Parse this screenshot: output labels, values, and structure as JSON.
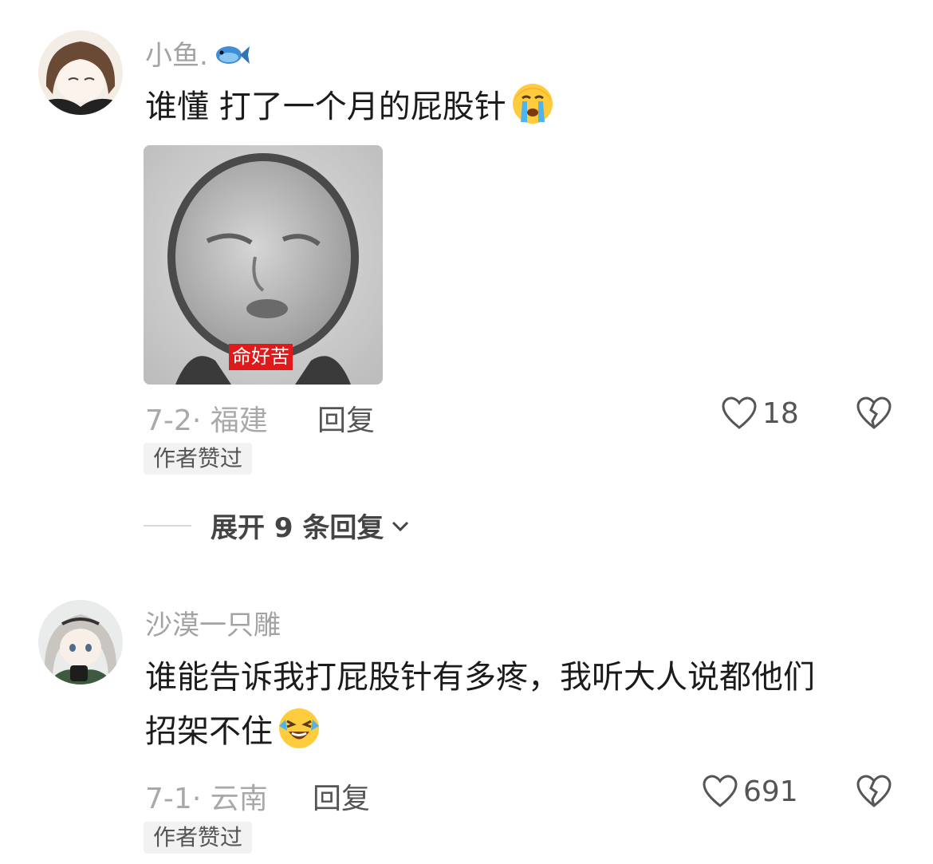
{
  "comments": [
    {
      "username": "小鱼.",
      "username_icon": "fish-icon",
      "text": "谁懂 打了一个月的屁股针",
      "text_emoji": "crying-face-emoji",
      "sticker": {
        "caption": "命好苦"
      },
      "date": "7-2",
      "location": "福建",
      "reply_label": "回复",
      "like_count": "18",
      "badge": "作者赞过",
      "expand_label": "展开 9 条回复"
    },
    {
      "username": "沙漠一只雕",
      "text_line1": "谁能告诉我打屁股针有多疼，我听大人说都他们",
      "text_line2": "招架不住",
      "text_emoji": "rolling-laughing-face-emoji",
      "date": "7-1",
      "location": "云南",
      "reply_label": "回复",
      "like_count": "691",
      "badge": "作者赞过"
    }
  ],
  "colors": {
    "username": "#a3a3a3",
    "meta": "#a9a9a9",
    "sticker_caption_bg": "#e0191b",
    "badge_bg": "#f2f2f2"
  }
}
